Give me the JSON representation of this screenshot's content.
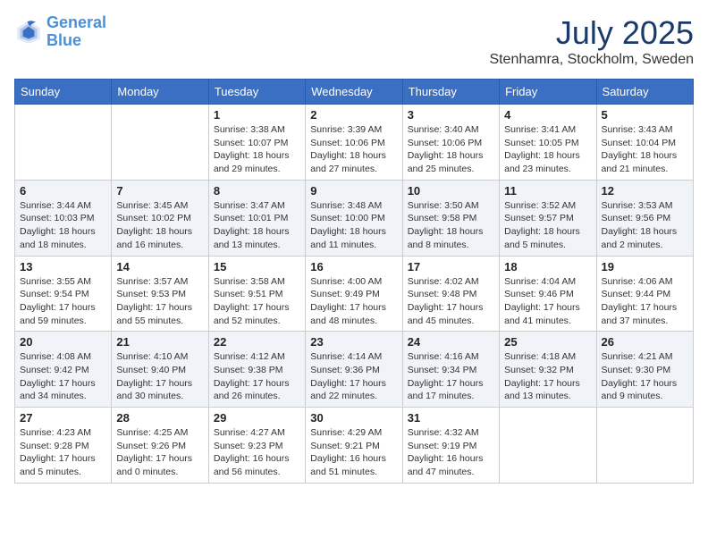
{
  "header": {
    "logo_line1": "General",
    "logo_line2": "Blue",
    "month_title": "July 2025",
    "location": "Stenhamra, Stockholm, Sweden"
  },
  "weekdays": [
    "Sunday",
    "Monday",
    "Tuesday",
    "Wednesday",
    "Thursday",
    "Friday",
    "Saturday"
  ],
  "weeks": [
    [
      {
        "day": "",
        "info": ""
      },
      {
        "day": "",
        "info": ""
      },
      {
        "day": "1",
        "info": "Sunrise: 3:38 AM\nSunset: 10:07 PM\nDaylight: 18 hours and 29 minutes."
      },
      {
        "day": "2",
        "info": "Sunrise: 3:39 AM\nSunset: 10:06 PM\nDaylight: 18 hours and 27 minutes."
      },
      {
        "day": "3",
        "info": "Sunrise: 3:40 AM\nSunset: 10:06 PM\nDaylight: 18 hours and 25 minutes."
      },
      {
        "day": "4",
        "info": "Sunrise: 3:41 AM\nSunset: 10:05 PM\nDaylight: 18 hours and 23 minutes."
      },
      {
        "day": "5",
        "info": "Sunrise: 3:43 AM\nSunset: 10:04 PM\nDaylight: 18 hours and 21 minutes."
      }
    ],
    [
      {
        "day": "6",
        "info": "Sunrise: 3:44 AM\nSunset: 10:03 PM\nDaylight: 18 hours and 18 minutes."
      },
      {
        "day": "7",
        "info": "Sunrise: 3:45 AM\nSunset: 10:02 PM\nDaylight: 18 hours and 16 minutes."
      },
      {
        "day": "8",
        "info": "Sunrise: 3:47 AM\nSunset: 10:01 PM\nDaylight: 18 hours and 13 minutes."
      },
      {
        "day": "9",
        "info": "Sunrise: 3:48 AM\nSunset: 10:00 PM\nDaylight: 18 hours and 11 minutes."
      },
      {
        "day": "10",
        "info": "Sunrise: 3:50 AM\nSunset: 9:58 PM\nDaylight: 18 hours and 8 minutes."
      },
      {
        "day": "11",
        "info": "Sunrise: 3:52 AM\nSunset: 9:57 PM\nDaylight: 18 hours and 5 minutes."
      },
      {
        "day": "12",
        "info": "Sunrise: 3:53 AM\nSunset: 9:56 PM\nDaylight: 18 hours and 2 minutes."
      }
    ],
    [
      {
        "day": "13",
        "info": "Sunrise: 3:55 AM\nSunset: 9:54 PM\nDaylight: 17 hours and 59 minutes."
      },
      {
        "day": "14",
        "info": "Sunrise: 3:57 AM\nSunset: 9:53 PM\nDaylight: 17 hours and 55 minutes."
      },
      {
        "day": "15",
        "info": "Sunrise: 3:58 AM\nSunset: 9:51 PM\nDaylight: 17 hours and 52 minutes."
      },
      {
        "day": "16",
        "info": "Sunrise: 4:00 AM\nSunset: 9:49 PM\nDaylight: 17 hours and 48 minutes."
      },
      {
        "day": "17",
        "info": "Sunrise: 4:02 AM\nSunset: 9:48 PM\nDaylight: 17 hours and 45 minutes."
      },
      {
        "day": "18",
        "info": "Sunrise: 4:04 AM\nSunset: 9:46 PM\nDaylight: 17 hours and 41 minutes."
      },
      {
        "day": "19",
        "info": "Sunrise: 4:06 AM\nSunset: 9:44 PM\nDaylight: 17 hours and 37 minutes."
      }
    ],
    [
      {
        "day": "20",
        "info": "Sunrise: 4:08 AM\nSunset: 9:42 PM\nDaylight: 17 hours and 34 minutes."
      },
      {
        "day": "21",
        "info": "Sunrise: 4:10 AM\nSunset: 9:40 PM\nDaylight: 17 hours and 30 minutes."
      },
      {
        "day": "22",
        "info": "Sunrise: 4:12 AM\nSunset: 9:38 PM\nDaylight: 17 hours and 26 minutes."
      },
      {
        "day": "23",
        "info": "Sunrise: 4:14 AM\nSunset: 9:36 PM\nDaylight: 17 hours and 22 minutes."
      },
      {
        "day": "24",
        "info": "Sunrise: 4:16 AM\nSunset: 9:34 PM\nDaylight: 17 hours and 17 minutes."
      },
      {
        "day": "25",
        "info": "Sunrise: 4:18 AM\nSunset: 9:32 PM\nDaylight: 17 hours and 13 minutes."
      },
      {
        "day": "26",
        "info": "Sunrise: 4:21 AM\nSunset: 9:30 PM\nDaylight: 17 hours and 9 minutes."
      }
    ],
    [
      {
        "day": "27",
        "info": "Sunrise: 4:23 AM\nSunset: 9:28 PM\nDaylight: 17 hours and 5 minutes."
      },
      {
        "day": "28",
        "info": "Sunrise: 4:25 AM\nSunset: 9:26 PM\nDaylight: 17 hours and 0 minutes."
      },
      {
        "day": "29",
        "info": "Sunrise: 4:27 AM\nSunset: 9:23 PM\nDaylight: 16 hours and 56 minutes."
      },
      {
        "day": "30",
        "info": "Sunrise: 4:29 AM\nSunset: 9:21 PM\nDaylight: 16 hours and 51 minutes."
      },
      {
        "day": "31",
        "info": "Sunrise: 4:32 AM\nSunset: 9:19 PM\nDaylight: 16 hours and 47 minutes."
      },
      {
        "day": "",
        "info": ""
      },
      {
        "day": "",
        "info": ""
      }
    ]
  ]
}
